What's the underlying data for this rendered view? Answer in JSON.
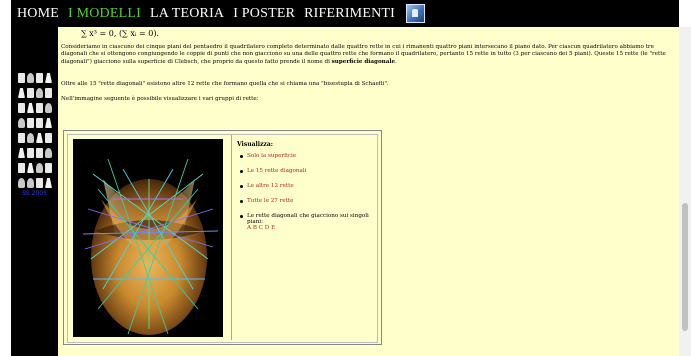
{
  "nav": {
    "items": [
      {
        "label": "HOME",
        "active": false
      },
      {
        "label": "I MODELLI",
        "active": true
      },
      {
        "label": "LA TEORIA",
        "active": false
      },
      {
        "label": "I POSTER",
        "active": false
      },
      {
        "label": "RIFERIMENTI",
        "active": false
      }
    ],
    "logo_icon": "site-logo-icon"
  },
  "sidebar": {
    "code_text": "SS 2005"
  },
  "content": {
    "formula": "∑ x³ = 0, (∑ xᵢ = 0).",
    "paragraph1_a": "Consideriamo in ciascuno dei cinque piani del pentaedro il quadrilatero completo determinato dalle quattro rette in cui i rimanenti quattro piani intersecano il piano dato. Per ciascun quadrilatero abbiamo tre diagonali che si ottengono congiungendo le coppie di punti che non giacciono su una delle quattro rette che formano il quadrilatero, pertanto 15 rette in tutto (3 per ciascuno dei 5 piani). Queste 15 rette (le \"rette diagonali\") giacciono sulla superficie di Clebsch, che proprio da questo fatto prende il nome di ",
    "paragraph1_bold": "superficie diagonale",
    "paragraph1_end": ".",
    "paragraph2": "Oltre alle 15 \"rette diagonali\" esistono altre 12 rette che formano quella che si chiama una \"bisestupla di Schaefli\".",
    "paragraph3": "Nell'immagine seguente è possibile visualizzare i vari gruppi di rette:"
  },
  "viz": {
    "title": "Visualizza:",
    "options": [
      "Solo la superficie",
      "Le 15 rette diagonali",
      "Le altre 12 rette",
      "Tutte le 27 rette"
    ],
    "planes_label": "Le rette diagonali che giacciono sui singoli piani:",
    "planes": [
      "A",
      "B",
      "C",
      "D",
      "E"
    ]
  },
  "colors": {
    "background": "#ffffcc",
    "nav_active": "#55d22a",
    "link": "#b22222",
    "chrome": "#000000"
  }
}
